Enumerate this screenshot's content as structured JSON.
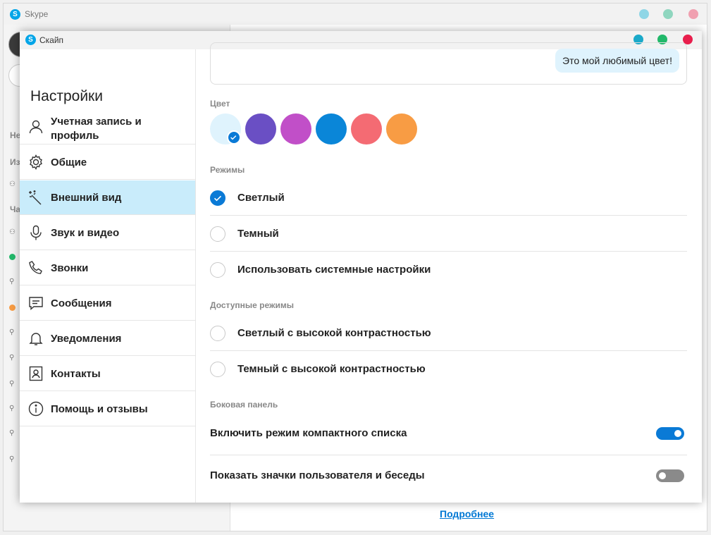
{
  "background_window": {
    "title": "Skype",
    "logo": "S",
    "letters": [
      "Не",
      "Из",
      "Ча"
    ],
    "more_link": "Подробнее",
    "window_buttons": [
      {
        "name": "minimize-button",
        "color": "#8fd6e6"
      },
      {
        "name": "maximize-button",
        "color": "#8fd6bf"
      },
      {
        "name": "close-button",
        "color": "#f0a0b0"
      }
    ]
  },
  "dialog": {
    "title": "Скайп",
    "logo": "S",
    "window_buttons": [
      {
        "name": "minimize-button",
        "color": "#1aa9c9"
      },
      {
        "name": "maximize-button",
        "color": "#22b86a"
      },
      {
        "name": "close-button",
        "color": "#e81e4c"
      }
    ],
    "heading": "Настройки",
    "nav": [
      {
        "id": "account",
        "label": "Учетная запись и профиль",
        "icon": "person-icon"
      },
      {
        "id": "general",
        "label": "Общие",
        "icon": "gear-icon"
      },
      {
        "id": "appearance",
        "label": "Внешний вид",
        "icon": "magic-wand-icon",
        "active": true
      },
      {
        "id": "audio-video",
        "label": "Звук и видео",
        "icon": "microphone-icon"
      },
      {
        "id": "calls",
        "label": "Звонки",
        "icon": "phone-icon"
      },
      {
        "id": "messaging",
        "label": "Сообщения",
        "icon": "message-icon"
      },
      {
        "id": "notifications",
        "label": "Уведомления",
        "icon": "bell-icon"
      },
      {
        "id": "contacts",
        "label": "Контакты",
        "icon": "contact-card-icon"
      },
      {
        "id": "help",
        "label": "Помощь и отзывы",
        "icon": "info-icon"
      }
    ],
    "appearance": {
      "preview_message": "Это мой любимый цвет!",
      "color_label": "Цвет",
      "colors": [
        {
          "name": "light-blue",
          "color": "#dff3fd",
          "selected": true
        },
        {
          "name": "purple",
          "color": "#6a4fc4"
        },
        {
          "name": "magenta",
          "color": "#c14fc8"
        },
        {
          "name": "blue",
          "color": "#0a86d8"
        },
        {
          "name": "coral",
          "color": "#f46b73"
        },
        {
          "name": "orange",
          "color": "#f89c44"
        }
      ],
      "modes_label": "Режимы",
      "modes": [
        {
          "label": "Светлый",
          "selected": true
        },
        {
          "label": "Темный",
          "selected": false
        },
        {
          "label": "Использовать системные настройки",
          "selected": false
        }
      ],
      "accessible_label": "Доступные режимы",
      "accessible_modes": [
        {
          "label": "Светлый с высокой контрастностью",
          "selected": false
        },
        {
          "label": "Темный с высокой контрастностью",
          "selected": false
        }
      ],
      "sidebar_label": "Боковая панель",
      "toggles": [
        {
          "label": "Включить режим компактного списка",
          "on": true
        },
        {
          "label": "Показать значки пользователя и беседы",
          "on": false
        }
      ],
      "accent_color": "#0a7ad6",
      "toggle_off_color": "#8a8a8a"
    }
  }
}
